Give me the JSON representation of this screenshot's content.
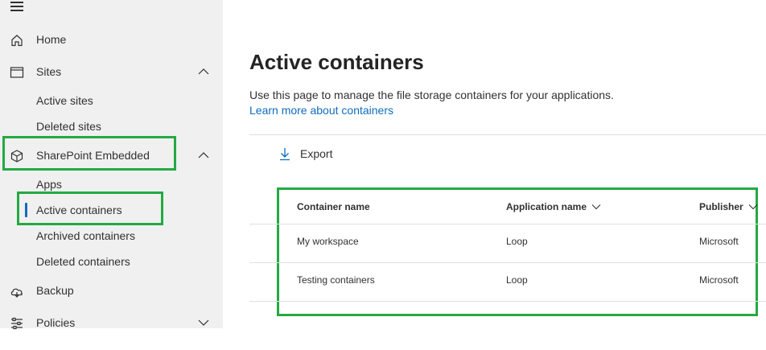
{
  "sidebar": {
    "items": [
      {
        "label": "Home",
        "icon": "home-icon"
      },
      {
        "label": "Sites",
        "icon": "sites-icon",
        "expanded": true
      },
      {
        "label": "Active sites"
      },
      {
        "label": "Deleted sites"
      },
      {
        "label": "SharePoint Embedded",
        "icon": "cube-icon",
        "expanded": true
      },
      {
        "label": "Apps"
      },
      {
        "label": "Active containers",
        "selected": true
      },
      {
        "label": "Archived containers"
      },
      {
        "label": "Deleted containers"
      },
      {
        "label": "Backup",
        "icon": "cloud-backup-icon"
      },
      {
        "label": "Policies",
        "icon": "sliders-icon",
        "expanded": false
      }
    ]
  },
  "main": {
    "title": "Active containers",
    "description": "Use this page to manage the file storage containers for your applications.",
    "learn_link": "Learn more about containers",
    "toolbar": {
      "export_label": "Export"
    },
    "table": {
      "columns": [
        "Container name",
        "Application name",
        "Publisher"
      ],
      "rows": [
        [
          "My workspace",
          "Loop",
          "Microsoft"
        ],
        [
          "Testing containers",
          "Loop",
          "Microsoft"
        ]
      ]
    }
  },
  "colors": {
    "accent": "#0f6cbd",
    "highlight": "#24a942",
    "sidebar_bg": "#f0f0f0"
  }
}
